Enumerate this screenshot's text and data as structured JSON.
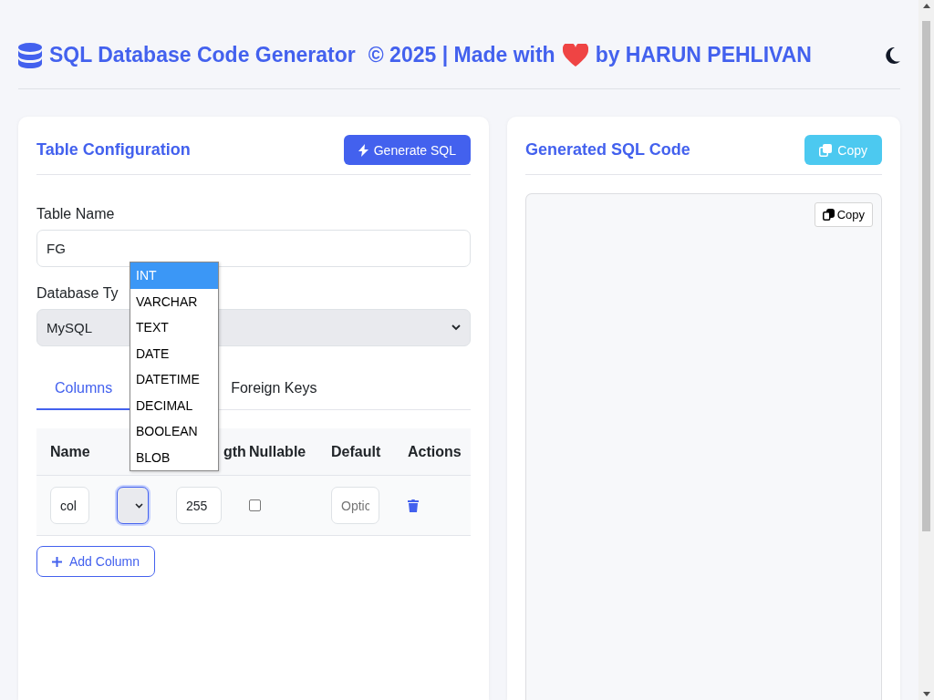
{
  "header": {
    "title": "SQL Database Code Generator",
    "credit_before": "© 2025 | Made with",
    "credit_after": "by HARUN PEHLIVAN"
  },
  "config": {
    "title": "Table Configuration",
    "generate_button": "Generate SQL",
    "table_name_label": "Table Name",
    "table_name_value": "FG",
    "database_type_label": "Database Ty",
    "database_type_value": "MySQL",
    "tabs": [
      {
        "label": "Columns",
        "selected": true
      },
      {
        "label": "Foreign Keys",
        "selected": false
      }
    ],
    "table": {
      "columns": [
        "Name",
        "gth",
        "Nullable",
        "Default",
        "Actions"
      ],
      "rows": [
        {
          "name": "col",
          "length": "255",
          "nullable": false,
          "default_placeholder": "Optic"
        }
      ]
    },
    "add_button": "Add Column"
  },
  "type_dropdown": {
    "options": [
      {
        "label": "INT",
        "selected": true
      },
      {
        "label": "VARCHAR",
        "selected": false
      },
      {
        "label": "TEXT",
        "selected": false
      },
      {
        "label": "DATE",
        "selected": false
      },
      {
        "label": "DATETIME",
        "selected": false
      },
      {
        "label": "DECIMAL",
        "selected": false
      },
      {
        "label": "BOOLEAN",
        "selected": false
      },
      {
        "label": "BLOB",
        "selected": false
      }
    ]
  },
  "output": {
    "title": "Generated SQL Code",
    "copy_button": "Copy",
    "inner_copy_button": "Copy"
  }
}
